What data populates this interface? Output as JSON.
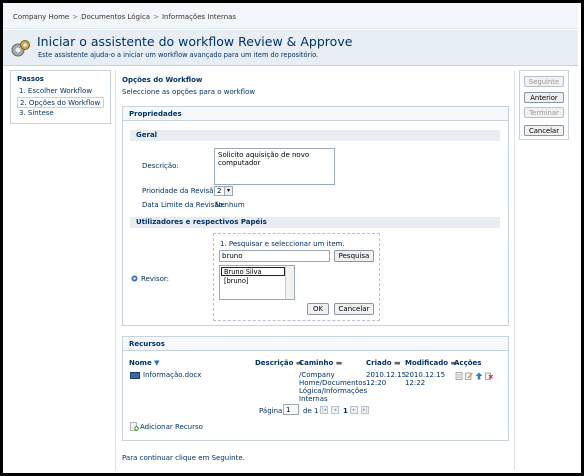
{
  "breadcrumb": [
    "Company Home",
    "Documentos Lógica",
    "Informações Internas"
  ],
  "header": {
    "title": "Iniciar o assistente do workflow Review & Approve",
    "subtitle": "Este assistente ajuda-o a iniciar um workflow avançado para um item do repositório."
  },
  "steps": {
    "title": "Passos",
    "items": [
      "1. Escolher Workflow",
      "2. Opções do Workflow",
      "3. Síntese"
    ]
  },
  "main": {
    "heading": "Opções do Workflow",
    "hint": "Seleccione as opções para o workflow",
    "footer": "Para continuar clique em Seguinte."
  },
  "properties": {
    "title": "Propriedades",
    "general_title": "Geral",
    "description_label": "Descrição:",
    "description_value": "Solicito aquisição de novo computador",
    "priority_label": "Prioridade da Revisão:",
    "priority_value": "2",
    "due_label": "Data Limite da Revisão:",
    "due_value": "Nenhum",
    "roles_title": "Utilizadores e respectivos Papéis",
    "reviewer_label": "Revisor:",
    "search_hint": "1. Pesquisar e seleccionar um item.",
    "search_value": "bruno",
    "search_button": "Pesquisa",
    "result_item": "Bruno Silva [bruno]",
    "ok_button": "OK",
    "cancel_button": "Cancelar"
  },
  "resources": {
    "title": "Recursos",
    "columns": [
      "Nome",
      "Descrição",
      "Caminho",
      "Criado",
      "Modificado",
      "Acções"
    ],
    "rows": [
      {
        "name": "Informação.docx",
        "path": [
          "/Company",
          "Home/Documentos",
          "Lógica/Informações",
          "Internas"
        ],
        "created": [
          "2010.12.15",
          "12:20"
        ],
        "modified": [
          "2010.12.15",
          "12:22"
        ]
      }
    ],
    "page_label": "Página",
    "page_value": "1",
    "of_label": "de 1",
    "current_page": "1",
    "add_label": "Adicionar Recurso"
  },
  "nav_buttons": {
    "next": "Seguinte",
    "back": "Anterior",
    "finish": "Terminar",
    "cancel": "Cancelar"
  }
}
